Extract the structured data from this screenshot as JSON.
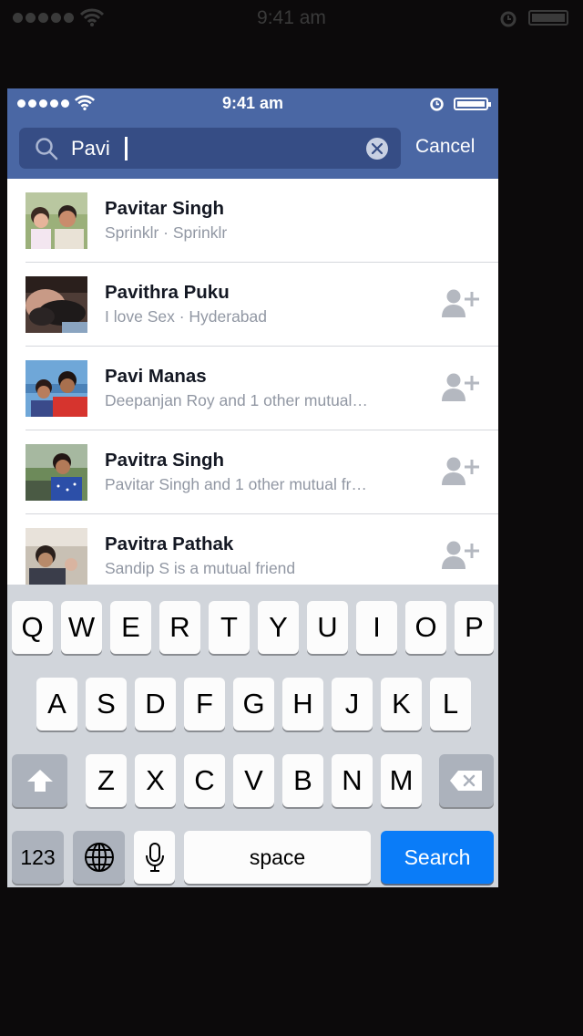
{
  "outer_status": {
    "time": "9:41 am"
  },
  "status": {
    "time": "9:41 am"
  },
  "search": {
    "value": "Pavi",
    "cancel_label": "Cancel"
  },
  "results": [
    {
      "name": "Pavitar Singh",
      "sub": "Sprinklr · Sprinklr",
      "add_friend": false
    },
    {
      "name": "Pavithra Puku",
      "sub": "I love Sex · Hyderabad",
      "add_friend": true
    },
    {
      "name": "Pavi Manas",
      "sub": "Deepanjan Roy and 1 other mutual…",
      "add_friend": true
    },
    {
      "name": "Pavitra Singh",
      "sub": "Pavitar Singh and 1 other mutual fr…",
      "add_friend": true
    },
    {
      "name": "Pavitra Pathak",
      "sub": "Sandip S is a mutual friend",
      "add_friend": true
    }
  ],
  "keyboard": {
    "row1": [
      "Q",
      "W",
      "E",
      "R",
      "T",
      "Y",
      "U",
      "I",
      "O",
      "P"
    ],
    "row2": [
      "A",
      "S",
      "D",
      "F",
      "G",
      "H",
      "J",
      "K",
      "L"
    ],
    "row3": [
      "Z",
      "X",
      "C",
      "V",
      "B",
      "N",
      "M"
    ],
    "numbers_label": "123",
    "space_label": "space",
    "search_label": "Search"
  },
  "colors": {
    "header": "#4a67a4",
    "search_field": "#364d85",
    "search_key": "#0a7cf8"
  }
}
